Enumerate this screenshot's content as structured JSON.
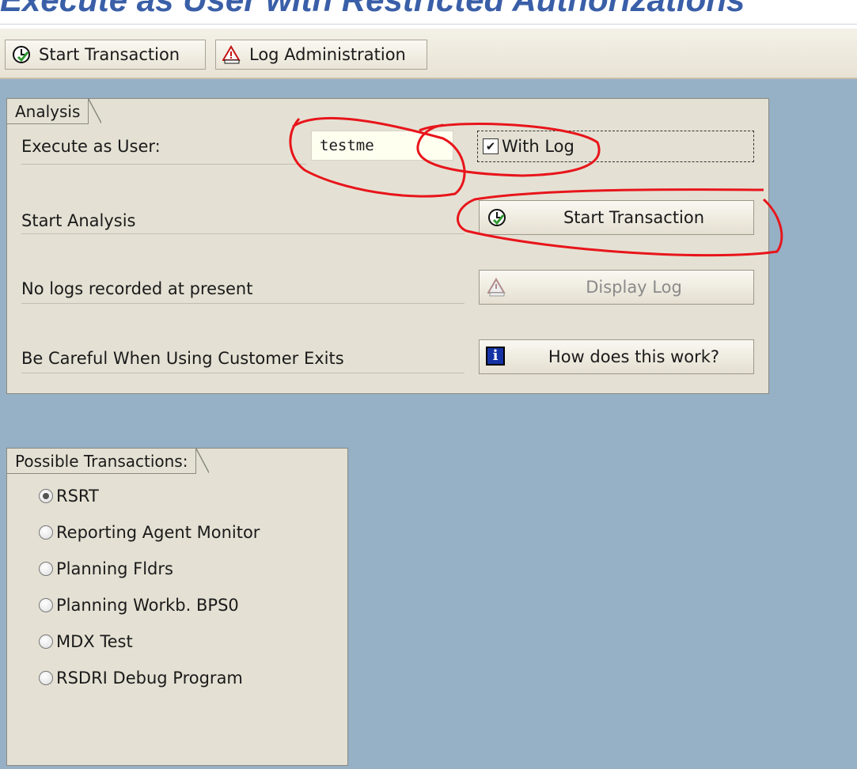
{
  "page_title": "Execute as User with Restricted Authorizations",
  "toolbar": {
    "start_transaction_label": "Start Transaction",
    "log_administration_label": "Log Administration"
  },
  "analysis": {
    "tab_label": "Analysis",
    "execute_as_user_label": "Execute as User:",
    "user_value": "testme",
    "with_log_label": "With Log",
    "with_log_checked": true,
    "start_analysis_label": "Start Analysis",
    "start_transaction_button": "Start Transaction",
    "no_logs_label": "No logs recorded at present",
    "display_log_button": "Display Log",
    "careful_label": "Be Careful When Using Customer Exits",
    "how_button": "How does this work?"
  },
  "transactions": {
    "tab_label": "Possible Transactions:",
    "options": [
      {
        "label": "RSRT",
        "selected": true
      },
      {
        "label": "Reporting Agent Monitor",
        "selected": false
      },
      {
        "label": "Planning Fldrs",
        "selected": false
      },
      {
        "label": "Planning Workb. BPS0",
        "selected": false
      },
      {
        "label": "MDX Test",
        "selected": false
      },
      {
        "label": "RSDRI Debug Program",
        "selected": false
      }
    ]
  },
  "colors": {
    "title": "#3a5fa8",
    "background": "#96b0c5",
    "panel": "#e4e1d4",
    "annotation": "#e8151b"
  },
  "icons": {
    "start_transaction": "clock-execute-icon",
    "log_administration": "warning-log-icon",
    "info": "info-icon"
  }
}
